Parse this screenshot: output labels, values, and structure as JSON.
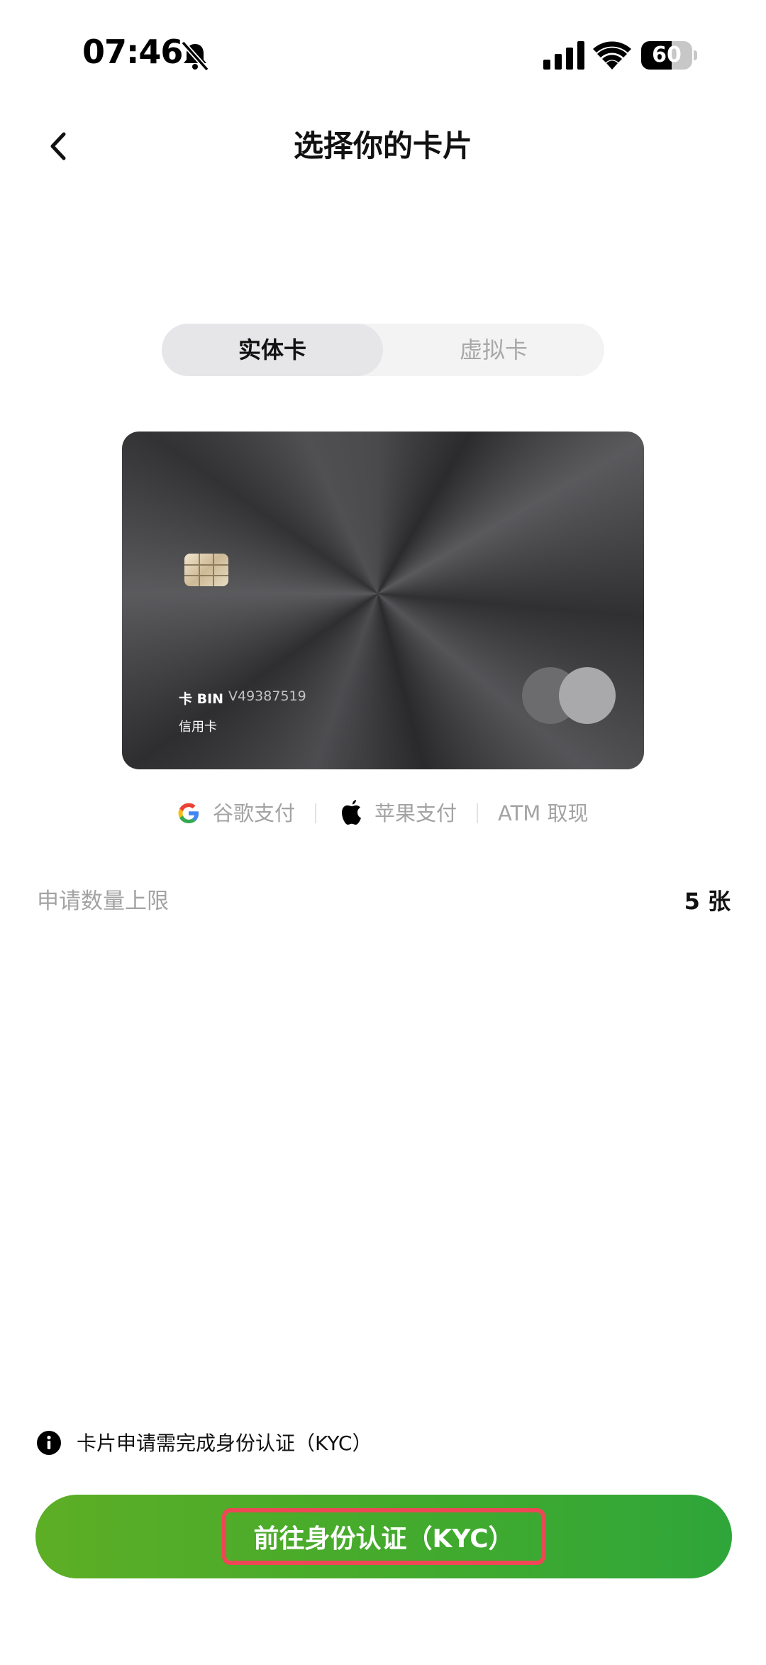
{
  "status_bar": {
    "time": "07:46",
    "battery_level": "60",
    "battery_fraction": 0.6
  },
  "header": {
    "title": "选择你的卡片",
    "back_icon": "chevron-left-icon"
  },
  "tabs": [
    {
      "label": "实体卡",
      "selected": true
    },
    {
      "label": "虚拟卡",
      "selected": false
    }
  ],
  "card": {
    "bin_label": "卡 BIN",
    "bin_value": "V49387519",
    "card_type": "信用卡"
  },
  "payment_methods": [
    {
      "icon": "google-icon",
      "label": "谷歌支付"
    },
    {
      "icon": "apple-icon",
      "label": "苹果支付"
    },
    {
      "icon": "",
      "label": "ATM 取现"
    }
  ],
  "limit": {
    "label": "申请数量上限",
    "value": "5 张"
  },
  "kyc_note": {
    "icon": "info-icon",
    "text": "卡片申请需完成身份认证（KYC）"
  },
  "primary_button": {
    "label": "前往身份认证（KYC）"
  },
  "colors": {
    "button_gradient_start": "#5dae25",
    "button_gradient_end": "#2fa63a",
    "highlight_border": "#ee4756",
    "muted_text": "#a3a3a3"
  }
}
